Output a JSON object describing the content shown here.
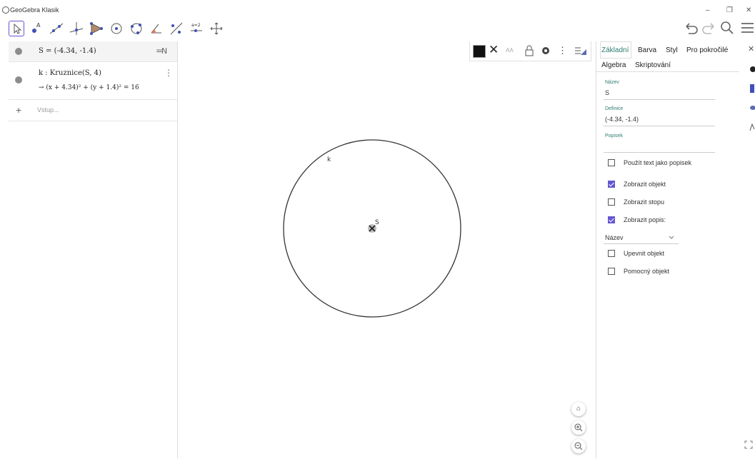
{
  "window": {
    "title": "GeoGebra Klasik",
    "controls": [
      "–",
      "❐",
      "✕"
    ]
  },
  "algebra": {
    "row1": "S = (-4.34, -1.4)",
    "row2_def": "k : Kruznice(S, 4)",
    "row2_eq": "→ (x + 4.34)² + (y + 1.4)² = 16",
    "input_placeholder": "Vstup..."
  },
  "graphics": {
    "circle_label": "k",
    "point_label": "S"
  },
  "props": {
    "tabs": [
      "Základní",
      "Barva",
      "Styl",
      "Pro pokročilé",
      "Algebra",
      "Skriptování"
    ],
    "name_label": "Název",
    "name_value": "S",
    "definition_label": "Definice",
    "definition_value": "(-4.34, -1.4)",
    "caption_label": "Popisek",
    "checkboxes": [
      {
        "label": "Použít text jako popisek",
        "checked": false
      },
      {
        "label": "Zobrazit objekt",
        "checked": true
      },
      {
        "label": "Zobrazit stopu",
        "checked": false
      },
      {
        "label": "Zobrazit popis:",
        "checked": true
      },
      {
        "label": "Upevnit objekt",
        "checked": false
      },
      {
        "label": "Pomocný objekt",
        "checked": false
      }
    ],
    "label_mode": "Název"
  },
  "accent_color": "#6557d2"
}
